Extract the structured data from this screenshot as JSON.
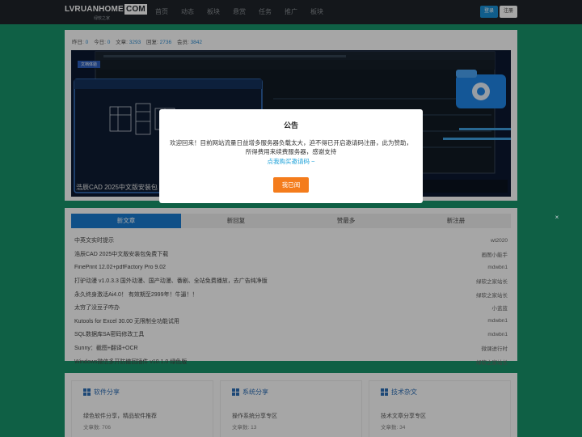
{
  "header": {
    "logo_main": "LVRUANHOME",
    "logo_com": "COM",
    "logo_sub": "绿软之家",
    "nav": [
      "首页",
      "动态",
      "板块",
      "悬赏",
      "任务",
      "推广",
      "板块"
    ],
    "login_label": "登录",
    "register_label": "注册"
  },
  "stats": {
    "today_label": "昨日:",
    "today_value": "0",
    "yesterday_label": "今日:",
    "yesterday_value": "0",
    "threads_label": "文章:",
    "threads_value": "3293",
    "replies_label": "回复:",
    "replies_value": "2736",
    "members_label": "会员:",
    "members_value": "3842"
  },
  "banner": {
    "caption": "浩辰CAD 2025中文版安装包",
    "badge": "文档体验"
  },
  "tabs": [
    "新文章",
    "新回复",
    "赞最多",
    "新注册"
  ],
  "threads": [
    {
      "title": "中英文实时提示",
      "user": "wt2020"
    },
    {
      "title": "浩辰CAD 2025中文版安装包免费下载",
      "user": "画图小能手"
    },
    {
      "title": "FinePrint 12.02+pdfFactory Pro 9.02",
      "user": "mdwbn1"
    },
    {
      "title": "打驴动漫 v1.0.3.3 国外动漫、国产动漫、番剧、全站免费播放，去广告纯净版",
      "user": "绿软之家站长"
    },
    {
      "title": "永久终身激活Ai4.0！ 有效期至2999年！牛逼！！",
      "user": "绿软之家站长"
    },
    {
      "title": "太穷了没豆子咋办",
      "user": "小蓝蓝"
    },
    {
      "title": "Kutools for Excel 30.00 无限制全功能试用",
      "user": "mdwbn1"
    },
    {
      "title": "SQL数据库SA密码修改工具",
      "user": "mdwbn1"
    },
    {
      "title": "Sunny：截图+翻译+OCR",
      "user": "微课进行时"
    },
    {
      "title": "Windows微信多开防撤回插件 v10.1.0 绿色版",
      "user": "绿软之家站长"
    }
  ],
  "forums": [
    {
      "title": "软件分享",
      "desc": "绿色软件分享，精品软件推荐",
      "count_label": "文章数:",
      "count": "706"
    },
    {
      "title": "系统分享",
      "desc": "操作系统分享专区",
      "count_label": "文章数:",
      "count": "13"
    },
    {
      "title": "技术杂文",
      "desc": "技术文章分享专区",
      "count_label": "文章数:",
      "count": "34"
    }
  ],
  "modal": {
    "title": "公告",
    "body": "欢迎回来！目前网站流量日益增多服务器负载太大，迫不得已开启邀请码注册，此为赞助，所得费用来续费服务器，感谢支持",
    "link": "点我购买邀请码 ~",
    "button": "我已阅"
  },
  "close_symbol": "×"
}
